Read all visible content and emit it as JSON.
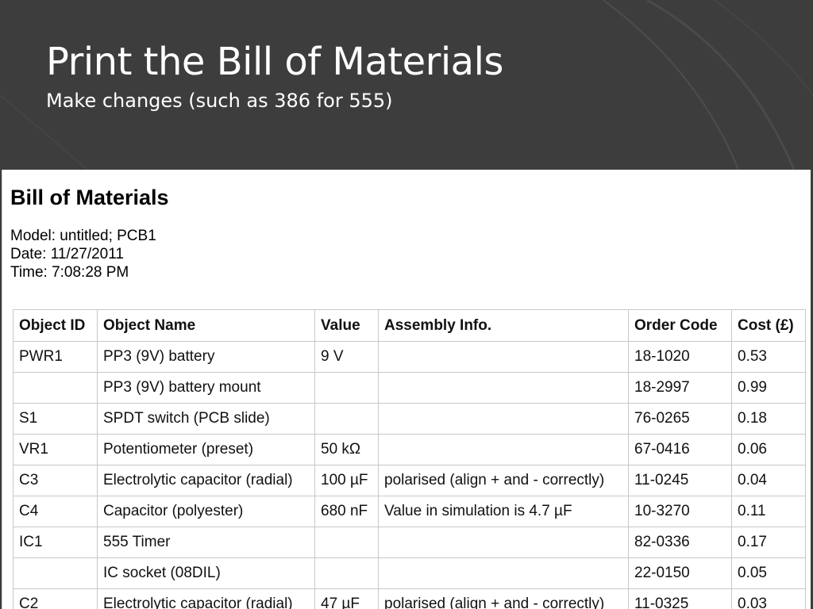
{
  "slide": {
    "title": "Print the Bill of Materials",
    "subtitle": "Make changes (such as 386 for 555)"
  },
  "document": {
    "heading": "Bill of Materials",
    "model": "Model: untitled; PCB1",
    "date": "Date: 11/27/2011",
    "time": "Time: 7:08:28 PM"
  },
  "table": {
    "headers": {
      "object_id": "Object ID",
      "object_name": "Object Name",
      "value": "Value",
      "assembly_info": "Assembly Info.",
      "order_code": "Order Code",
      "cost": "Cost (£)"
    },
    "rows": [
      {
        "id": "PWR1",
        "name": "PP3 (9V) battery",
        "value": "9 V",
        "assembly": "",
        "code": "18-1020",
        "cost": "0.53"
      },
      {
        "id": "",
        "name": "PP3 (9V) battery mount",
        "value": "",
        "assembly": "",
        "code": "18-2997",
        "cost": "0.99"
      },
      {
        "id": "S1",
        "name": "SPDT switch (PCB slide)",
        "value": "",
        "assembly": "",
        "code": "76-0265",
        "cost": "0.18"
      },
      {
        "id": "VR1",
        "name": "Potentiometer (preset)",
        "value": "50 kΩ",
        "assembly": "",
        "code": "67-0416",
        "cost": "0.06"
      },
      {
        "id": "C3",
        "name": "Electrolytic capacitor (radial)",
        "value": "100 µF",
        "assembly": "polarised (align + and - correctly)",
        "code": "11-0245",
        "cost": "0.04"
      },
      {
        "id": "C4",
        "name": "Capacitor (polyester)",
        "value": "680 nF",
        "assembly": "Value in simulation is 4.7 µF",
        "code": "10-3270",
        "cost": "0.11"
      },
      {
        "id": "IC1",
        "name": "555 Timer",
        "value": "",
        "assembly": "",
        "code": "82-0336",
        "cost": "0.17"
      },
      {
        "id": "",
        "name": "IC socket (08DIL)",
        "value": "",
        "assembly": "",
        "code": "22-0150",
        "cost": "0.05"
      },
      {
        "id": "C2",
        "name": "Electrolytic capacitor (radial)",
        "value": "47 µF",
        "assembly": "polarised (align + and - correctly)",
        "code": "11-0325",
        "cost": "0.03"
      }
    ]
  }
}
